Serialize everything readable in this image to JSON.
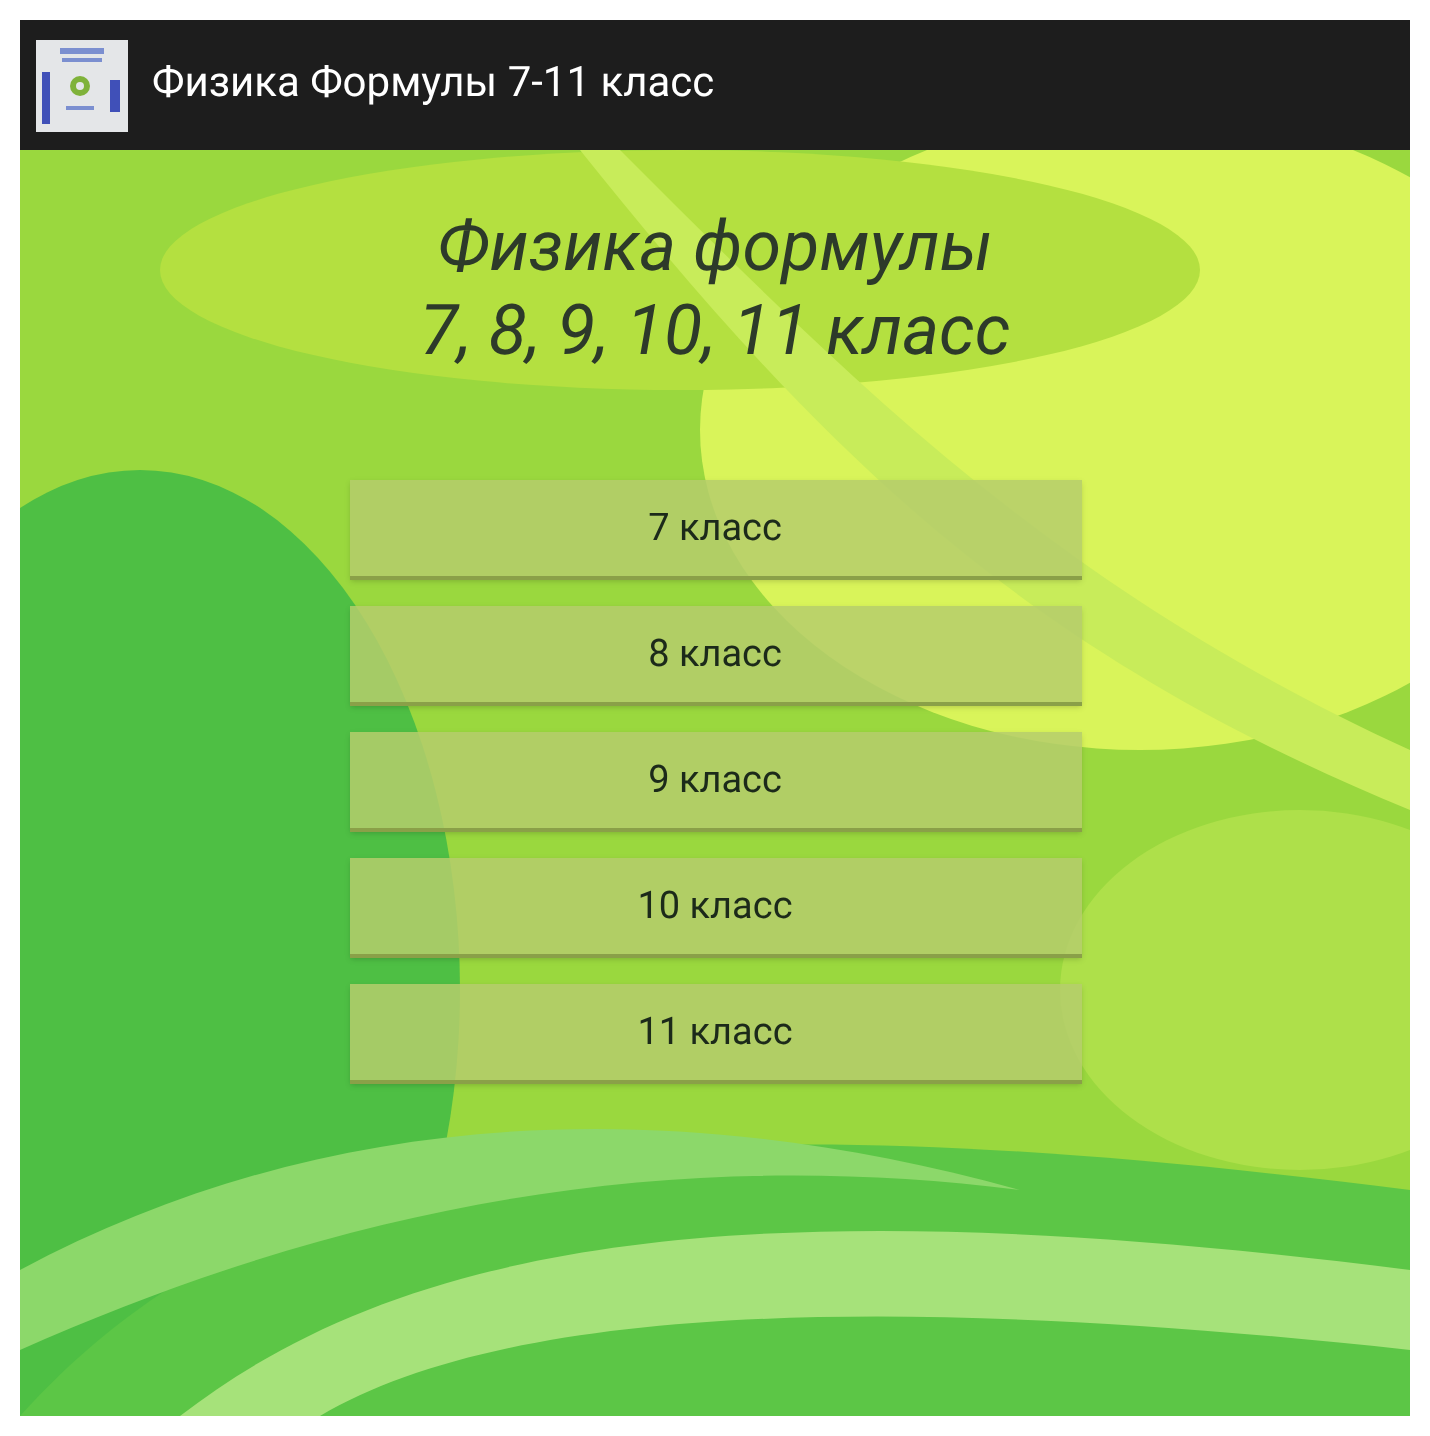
{
  "action_bar": {
    "title": "Физика Формулы 7-11 класс"
  },
  "heading": {
    "lines": [
      "Физика формулы",
      "7, 8, 9, 10, 11 класс"
    ]
  },
  "buttons": [
    {
      "label": "7 класс"
    },
    {
      "label": "8 класс"
    },
    {
      "label": "9 класс"
    },
    {
      "label": "10 класс"
    },
    {
      "label": "11 класс"
    }
  ]
}
